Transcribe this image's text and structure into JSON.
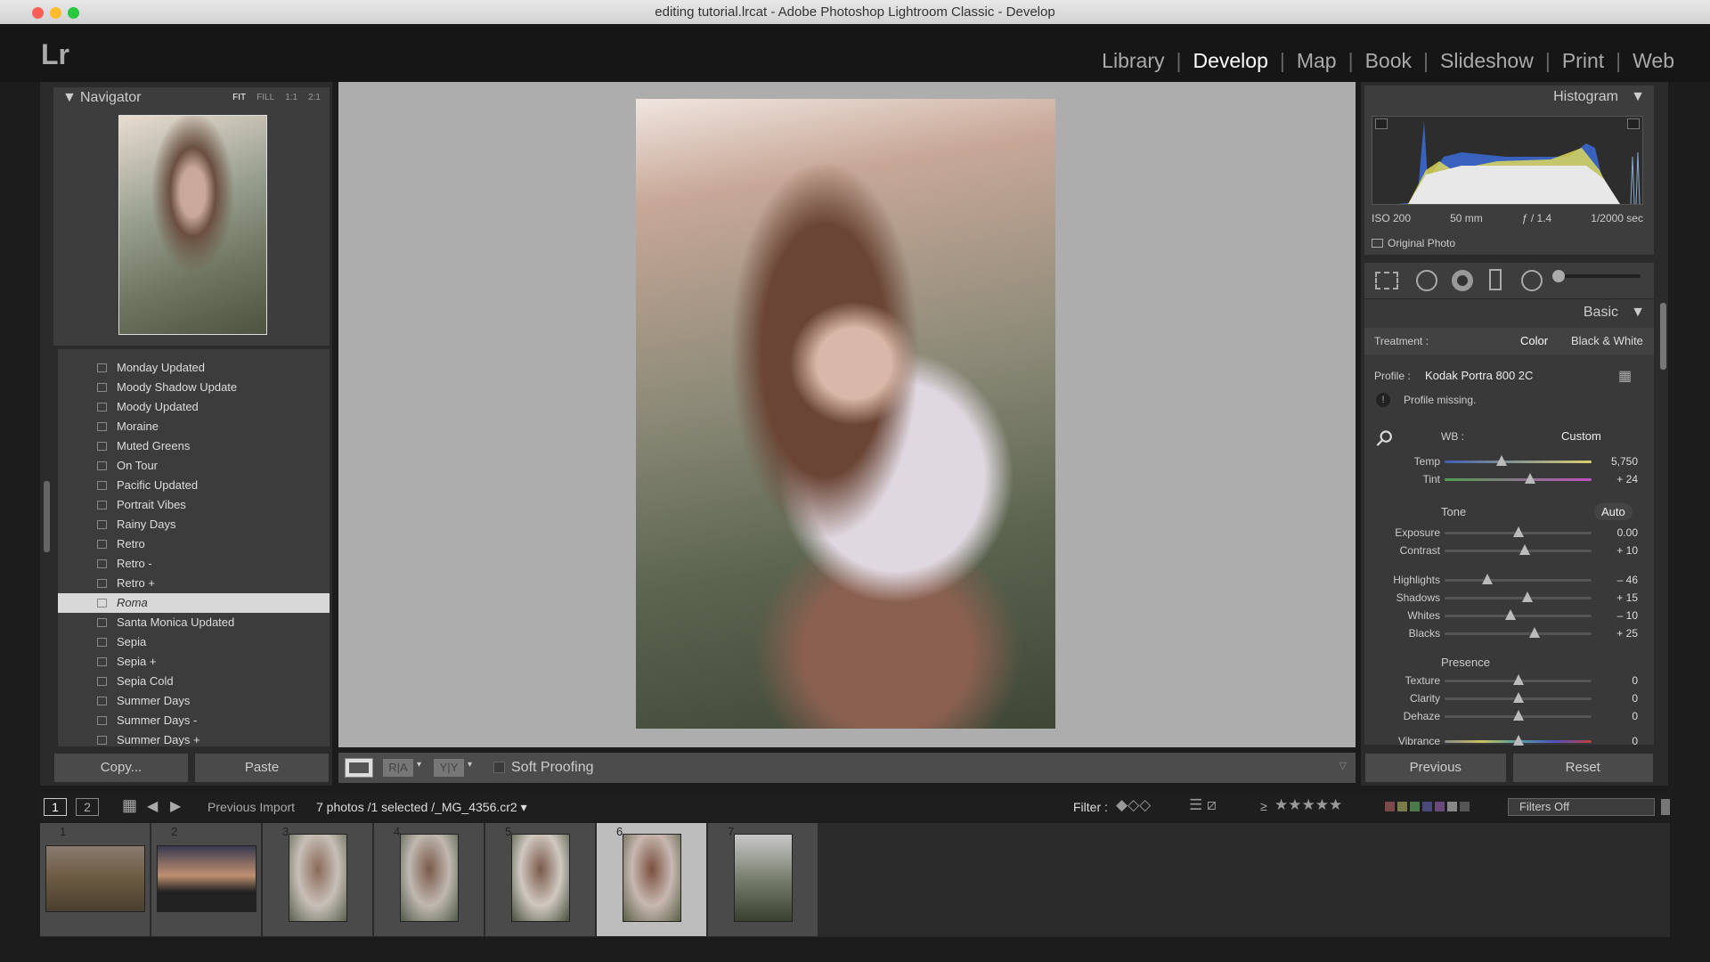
{
  "window": {
    "title": "editing tutorial.lrcat - Adobe Photoshop Lightroom Classic - Develop"
  },
  "app": {
    "logo": "Lr"
  },
  "modules": [
    {
      "label": "Library"
    },
    {
      "label": "Develop",
      "active": true
    },
    {
      "label": "Map"
    },
    {
      "label": "Book"
    },
    {
      "label": "Slideshow"
    },
    {
      "label": "Print"
    },
    {
      "label": "Web"
    }
  ],
  "navigator": {
    "title": "Navigator",
    "zoom": [
      "FIT",
      "FILL",
      "1:1",
      "2:1"
    ]
  },
  "presets": [
    "Monday Updated",
    "Moody Shadow Update",
    "Moody Updated",
    "Moraine",
    "Muted Greens",
    "On Tour",
    "Pacific Updated",
    "Portrait Vibes",
    "Rainy Days",
    "Retro",
    "Retro -",
    "Retro +",
    "Roma",
    "Santa Monica Updated",
    "Sepia",
    "Sepia +",
    "Sepia Cold",
    "Summer Days",
    "Summer Days -",
    "Summer Days +"
  ],
  "selected_preset": "Roma",
  "left_buttons": {
    "copy": "Copy...",
    "paste": "Paste"
  },
  "toolbar": {
    "soft_proofing": "Soft Proofing",
    "before_after": "R|A",
    "ya": "Y|Y"
  },
  "histogram": {
    "title": "Histogram",
    "iso": "ISO 200",
    "focal": "50 mm",
    "aperture": "ƒ / 1.4",
    "shutter": "1/2000 sec",
    "original_photo": "Original Photo"
  },
  "basic": {
    "title": "Basic",
    "treatment_label": "Treatment :",
    "color": "Color",
    "bw": "Black & White",
    "profile_label": "Profile :",
    "profile": "Kodak Portra 800 2C",
    "profile_warning": "Profile missing.",
    "wb_label": "WB :",
    "wb": "Custom",
    "tone": "Tone",
    "auto": "Auto",
    "presence": "Presence"
  },
  "sliders": [
    {
      "label": "Temp",
      "value": "5,750",
      "position": 0.39
    },
    {
      "label": "Tint",
      "value": "+ 24",
      "position": 0.58
    },
    {
      "label": "Exposure",
      "value": "0.00",
      "position": 0.5
    },
    {
      "label": "Contrast",
      "value": "+ 10",
      "position": 0.545
    },
    {
      "label": "Highlights",
      "value": "– 46",
      "position": 0.29
    },
    {
      "label": "Shadows",
      "value": "+ 15",
      "position": 0.565
    },
    {
      "label": "Whites",
      "value": "– 10",
      "position": 0.45
    },
    {
      "label": "Blacks",
      "value": "+ 25",
      "position": 0.61
    },
    {
      "label": "Texture",
      "value": "0",
      "position": 0.5
    },
    {
      "label": "Clarity",
      "value": "0",
      "position": 0.5
    },
    {
      "label": "Dehaze",
      "value": "0",
      "position": 0.5
    },
    {
      "label": "Vibrance",
      "value": "0",
      "position": 0.5
    }
  ],
  "right_buttons": {
    "previous": "Previous",
    "reset": "Reset"
  },
  "filmstrip_bar": {
    "view1": "1",
    "view2": "2",
    "source": "Previous Import",
    "info": "7 photos /1 selected /_MG_4356.cr2",
    "filter_label": "Filter :",
    "rating_op": "≥",
    "filter_value": "Filters Off"
  },
  "filmstrip": [
    {
      "n": "1"
    },
    {
      "n": "2"
    },
    {
      "n": "3"
    },
    {
      "n": "4"
    },
    {
      "n": "5"
    },
    {
      "n": "6",
      "selected": true
    },
    {
      "n": "7"
    }
  ]
}
